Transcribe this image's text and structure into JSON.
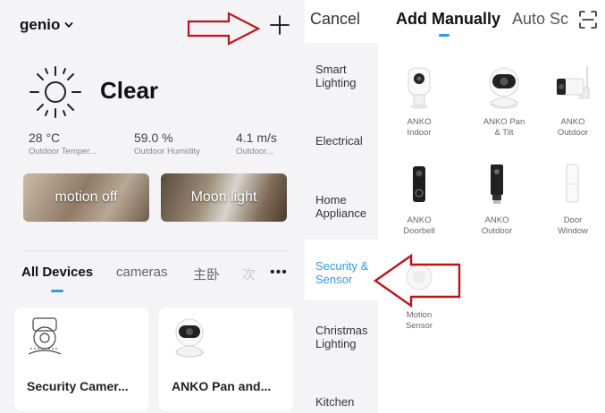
{
  "home": {
    "name": "genio",
    "weather": {
      "condition": "Clear",
      "stats": [
        {
          "value": "28 °C",
          "label": "Outdoor Temper..."
        },
        {
          "value": "59.0 %",
          "label": "Outdoor Humidity"
        },
        {
          "value": "4.1 m/s",
          "label": "Outdoor..."
        }
      ]
    },
    "scenes": [
      "motion off",
      "Moon light"
    ],
    "tabs": [
      "All Devices",
      "cameras",
      "主卧",
      "次"
    ],
    "more": "•••",
    "devices": [
      "Security Camer...",
      "ANKO Pan and..."
    ]
  },
  "add_panel": {
    "cancel": "Cancel",
    "title": "Add Manually",
    "auto_scan": "Auto Sc",
    "categories": [
      [
        "Smart",
        "Lighting"
      ],
      [
        "Electrical"
      ],
      [
        "Home",
        "Appliance"
      ],
      [
        "Security &",
        "Sensor"
      ],
      [
        "Christmas",
        "Lighting"
      ],
      [
        "Kitchen"
      ]
    ],
    "active_category_index": 3,
    "devices": [
      [
        "ANKO",
        "Indoor"
      ],
      [
        "ANKO Pan",
        "& Tilt"
      ],
      [
        "ANKO",
        "Outdoor"
      ],
      [
        "ANKO",
        "Doorbell"
      ],
      [
        "ANKO",
        "Outdoor"
      ],
      [
        "Door",
        "Window"
      ],
      [
        "Motion",
        "Sensor"
      ]
    ]
  },
  "colors": {
    "accent": "#2e9bea",
    "arrow": "#c0121b",
    "panel_bg": "#f4f4f6"
  },
  "icons": [
    "chevron-down-icon",
    "plus-icon",
    "sun-icon",
    "scan-icon",
    "more-icon"
  ]
}
